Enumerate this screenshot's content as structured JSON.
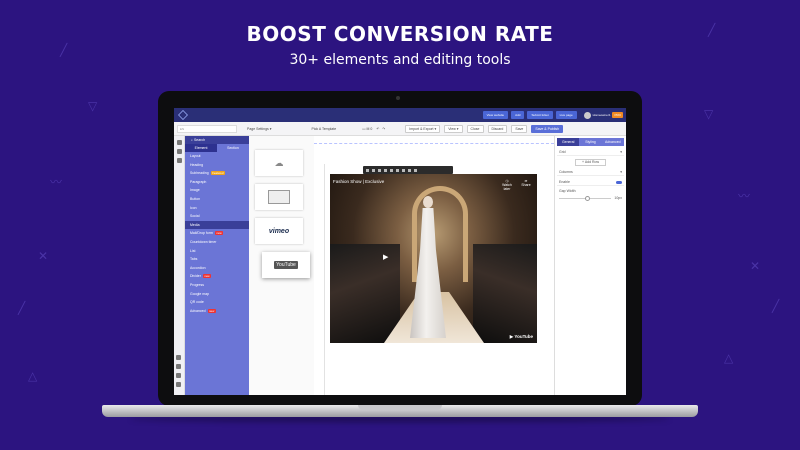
{
  "hero": {
    "title": "BOOST CONVERSION RATE",
    "subtitle": "30+ elements and editing tools"
  },
  "colors": {
    "background": "#2c1480",
    "sidebar": "#6b75d6",
    "topbar": "#2a2f77",
    "primary_button": "#5a6fd8"
  },
  "topbar": {
    "buttons": [
      "View website",
      "Add",
      "Submit ticket",
      "Live page"
    ],
    "user_name": "Homeowner1",
    "user_badge": "PRO"
  },
  "toolbar": {
    "input_value": "EN",
    "page_settings": "Page Settings",
    "pick_template": "Pick A Template",
    "zoom": "M",
    "zoom_value": "0",
    "import_export": "Import & Export",
    "view": "View",
    "close": "Close",
    "discard": "Discard",
    "save": "Save",
    "save_publish": "Save & Publish"
  },
  "sidebar": {
    "search": "Search",
    "tabs": [
      "Element",
      "Section"
    ],
    "items": [
      {
        "label": "Layout",
        "tag": ""
      },
      {
        "label": "Heading",
        "tag": ""
      },
      {
        "label": "Subheading",
        "tag": "Featured"
      },
      {
        "label": "Paragraph",
        "tag": ""
      },
      {
        "label": "Image",
        "tag": ""
      },
      {
        "label": "Button",
        "tag": ""
      },
      {
        "label": "Icon",
        "tag": ""
      },
      {
        "label": "Social",
        "tag": ""
      },
      {
        "label": "Media",
        "tag": "",
        "active": true
      },
      {
        "label": "Mail/Drop form",
        "tag": "new"
      },
      {
        "label": "Countdown timer",
        "tag": ""
      },
      {
        "label": "List",
        "tag": ""
      },
      {
        "label": "Tabs",
        "tag": ""
      },
      {
        "label": "Accordion",
        "tag": ""
      },
      {
        "label": "Divider",
        "tag": "new"
      },
      {
        "label": "Progress",
        "tag": ""
      },
      {
        "label": "Google map",
        "tag": ""
      },
      {
        "label": "QR code",
        "tag": ""
      },
      {
        "label": "Advanced",
        "tag": "new"
      }
    ]
  },
  "elements": {
    "cards": [
      {
        "name": "soundcloud",
        "label": ""
      },
      {
        "name": "video",
        "label": ""
      },
      {
        "name": "vimeo",
        "label": "vimeo"
      },
      {
        "name": "youtube",
        "label": "YouTube"
      }
    ]
  },
  "video": {
    "title": "Fashion Show | Exclusive",
    "watch_later": "Watch later",
    "share": "Share",
    "logo": "YouTube"
  },
  "panel": {
    "tabs": [
      "General",
      "Styling",
      "Advanced"
    ],
    "rows": [
      "Grid",
      "Add Row",
      "Columns",
      "Enable"
    ],
    "slider_label": "Gap Width",
    "slider_value": "10px"
  }
}
